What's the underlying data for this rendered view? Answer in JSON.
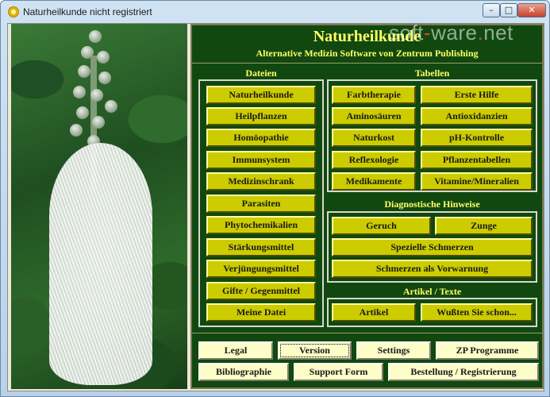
{
  "window": {
    "title": "Naturheilkunde nicht registriert",
    "controls": {
      "minimize": "–",
      "maximize": "□",
      "close": "✕"
    },
    "icon": "flower-icon"
  },
  "watermark": {
    "part1": "soft",
    "dot": "-",
    "part2": "ware",
    "dot2": ".",
    "part3": "net"
  },
  "header": {
    "title": "Naturheilkunde",
    "subtitle": "Alternative Medizin Software von Zentrum Publishing"
  },
  "sections": {
    "dateien": "Dateien",
    "tabellen": "Tabellen",
    "diagnostik": "Diagnostische Hinweise",
    "artikel": "Artikel / Texte"
  },
  "dateien_buttons": [
    "Naturheilkunde",
    "Heilpflanzen",
    "Homöopathie",
    "Immunsystem",
    "Medizinschrank",
    "Parasiten",
    "Phytochemikalien",
    "Stärkungsmittel",
    "Verjüngungsmittel",
    "Gifte / Gegenmittel",
    "Meine Datei"
  ],
  "tabellen_buttons": [
    "Farbtherapie",
    "Erste Hilfe",
    "Aminosäuren",
    "Antioxidanzien",
    "Naturkost",
    "pH-Kontrolle",
    "Reflexologie",
    "Pflanzentabellen",
    "Medikamente",
    "Vitamine/Mineralien"
  ],
  "diagnostik_buttons": [
    "Geruch",
    "Zunge",
    "Spezielle Schmerzen",
    "Schmerzen als Vorwarnung"
  ],
  "artikel_buttons": [
    "Artikel",
    "Wußten Sie schon..."
  ],
  "footer_buttons": {
    "legal": "Legal",
    "version": "Version",
    "settings": "Settings",
    "zp_programme": "ZP Programme",
    "bibliographie": "Bibliographie",
    "support_form": "Support Form",
    "bestellung": "Bestellung / Registrierung"
  },
  "colors": {
    "panel_bg": "#11480f",
    "title_yellow": "#ffff66",
    "button_yellow": "#cccc00",
    "button_light": "#fdfdc8"
  }
}
